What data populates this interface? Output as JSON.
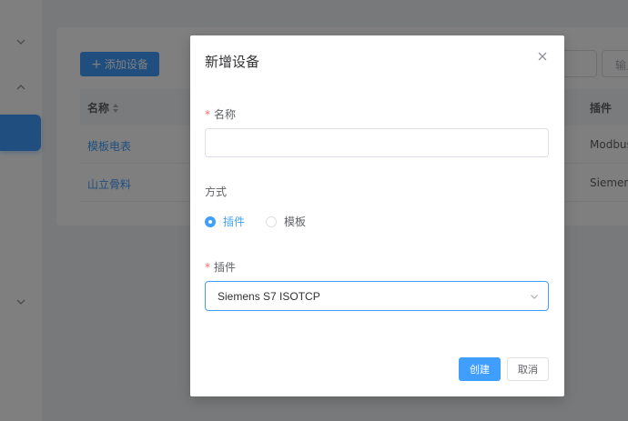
{
  "background": {
    "toolbar": {
      "add_label": "添加设备",
      "search_placeholder": "输入"
    },
    "table": {
      "columns": [
        "名称",
        "插件"
      ],
      "rows": [
        {
          "name": "模板电表",
          "plugin": "Modbus"
        },
        {
          "name": "山立骨料",
          "plugin": "Siemens"
        }
      ]
    }
  },
  "dialog": {
    "title": "新增设备",
    "name_label": "名称",
    "name_value": "",
    "mode_label": "方式",
    "mode_options": [
      {
        "label": "插件",
        "checked": true
      },
      {
        "label": "模板",
        "checked": false
      }
    ],
    "plugin_label": "插件",
    "plugin_value": "Siemens S7 ISOTCP",
    "create_label": "创建",
    "cancel_label": "取消"
  },
  "icons": [
    "chevron-down-icon",
    "chevron-up-icon",
    "plus-icon",
    "sort-icon",
    "close-icon"
  ],
  "colors": {
    "primary": "#409eff",
    "required": "#f56c6c",
    "overlay": "rgba(0,0,0,0.5)"
  }
}
